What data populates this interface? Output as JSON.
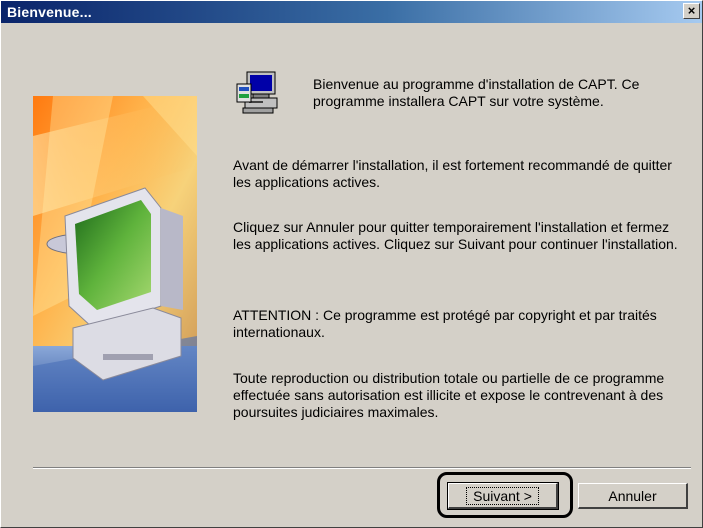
{
  "window": {
    "title": "Bienvenue...",
    "close_glyph": "×"
  },
  "content": {
    "intro": "Bienvenue au programme d'installation de CAPT. Ce programme installera CAPT sur votre système.",
    "para1": "Avant de démarrer l'installation, il est fortement recommandé de quitter les applications actives.",
    "para2": "Cliquez sur Annuler pour quitter temporairement l'installation et fermez les applications actives. Cliquez sur Suivant pour continuer l'installation.",
    "para3": "ATTENTION : Ce programme est protégé par copyright et par traités internationaux.",
    "para4": "Toute reproduction ou distribution totale ou partielle de ce programme effectuée sans autorisation est illicite et expose le contrevenant à des poursuites judiciaires maximales."
  },
  "buttons": {
    "next_label": "Suivant >",
    "cancel_label": "Annuler"
  },
  "icons": {
    "side_image": "computer-illustration",
    "app": "installer-computer-icon"
  },
  "colors": {
    "titlebar_start": "#0a246a",
    "titlebar_end": "#a6caf0",
    "dialog_bg": "#d4d0c8"
  }
}
